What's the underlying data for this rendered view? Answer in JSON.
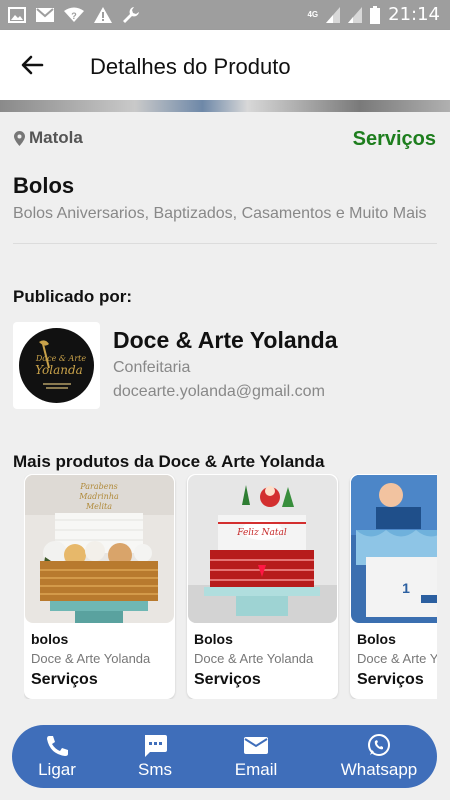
{
  "status_bar": {
    "time": "21:14",
    "network": "4G",
    "icons": [
      "image-icon",
      "mail-icon",
      "wifi-question-icon",
      "warning-icon",
      "wrench-icon",
      "signal-icon",
      "signal-icon",
      "battery-icon"
    ]
  },
  "app_bar": {
    "title": "Detalhes do Produto",
    "back_icon": "back-arrow-icon"
  },
  "product": {
    "location": "Matola",
    "category": "Serviços",
    "title": "Bolos",
    "description": "Bolos Aniversarios, Baptizados, Casamentos e Muito Mais"
  },
  "publisher": {
    "label": "Publicado por:",
    "name": "Doce & Arte Yolanda",
    "type": "Confeitaria",
    "email": "docearte.yolanda@gmail.com",
    "logo_text": "Doce & Arte Yolanda"
  },
  "more_products": {
    "label": "Mais produtos da Doce & Arte Yolanda",
    "items": [
      {
        "name": "bolos",
        "seller": "Doce & Arte Yolanda",
        "category": "Serviços",
        "topper": "Parabens Madrinha Melita"
      },
      {
        "name": "Bolos",
        "seller": "Doce & Arte Yolanda",
        "category": "Serviços",
        "topper": "Feliz Natal"
      },
      {
        "name": "Bolos",
        "seller": "Doce & Arte Yolanda",
        "category": "Serviços",
        "topper": "1"
      }
    ]
  },
  "bottom_bar": {
    "items": [
      {
        "label": "Ligar",
        "icon": "phone-icon"
      },
      {
        "label": "Sms",
        "icon": "sms-icon"
      },
      {
        "label": "Email",
        "icon": "email-icon"
      },
      {
        "label": "Whatsapp",
        "icon": "whatsapp-icon"
      }
    ]
  },
  "colors": {
    "accent": "#3f6eba",
    "category_green": "#1e7e1e",
    "status_bar": "#9e9e9e"
  }
}
